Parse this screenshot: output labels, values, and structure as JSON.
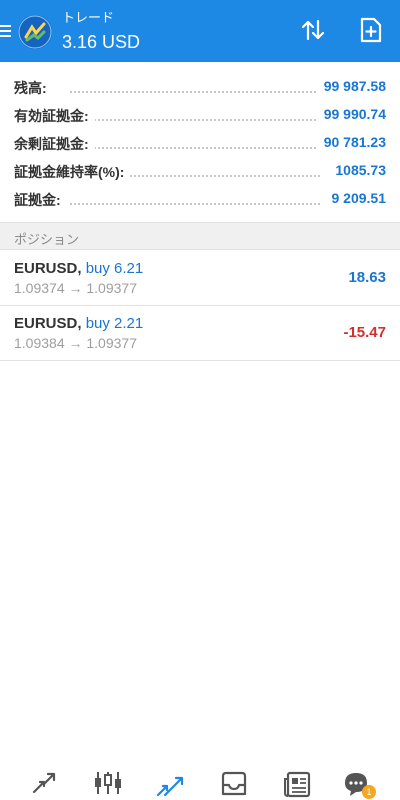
{
  "header": {
    "subtitle": "トレード",
    "title": "3.16 USD",
    "menu_icon": "hamburger-menu-icon",
    "logo_icon": "metatrader-logo-icon",
    "sort_icon": "sort-arrows-icon",
    "new_order_icon": "new-order-file-plus-icon"
  },
  "summary": [
    {
      "label": "残高:",
      "value": "99 987.58"
    },
    {
      "label": "有効証拠金:",
      "value": "99 990.74"
    },
    {
      "label": "余剰証拠金:",
      "value": "90 781.23"
    },
    {
      "label": "証拠金維持率(%):",
      "value": "1085.73"
    },
    {
      "label": "証拠金:",
      "value": "9 209.51"
    }
  ],
  "positions_header": "ポジション",
  "positions": [
    {
      "symbol": "EURUSD,",
      "type": "buy 6.21",
      "prices": "1.09374 → 1.09377",
      "profit": "18.63",
      "profit_color": "#1976d2"
    },
    {
      "symbol": "EURUSD,",
      "type": "buy 2.21",
      "prices": "1.09384 → 1.09377",
      "profit": "-15.47",
      "profit_color": "#d32f2f"
    }
  ],
  "bottom_nav": {
    "items": [
      "quotes-icon",
      "chart-candles-icon",
      "trade-icon",
      "history-inbox-icon",
      "news-icon",
      "chat-icon"
    ],
    "active": "trade-icon",
    "chat_badge": "1"
  },
  "colors": {
    "accent": "#1e88e5",
    "positive": "#1976d2",
    "negative": "#d32f2f",
    "badge": "#f5a623"
  }
}
